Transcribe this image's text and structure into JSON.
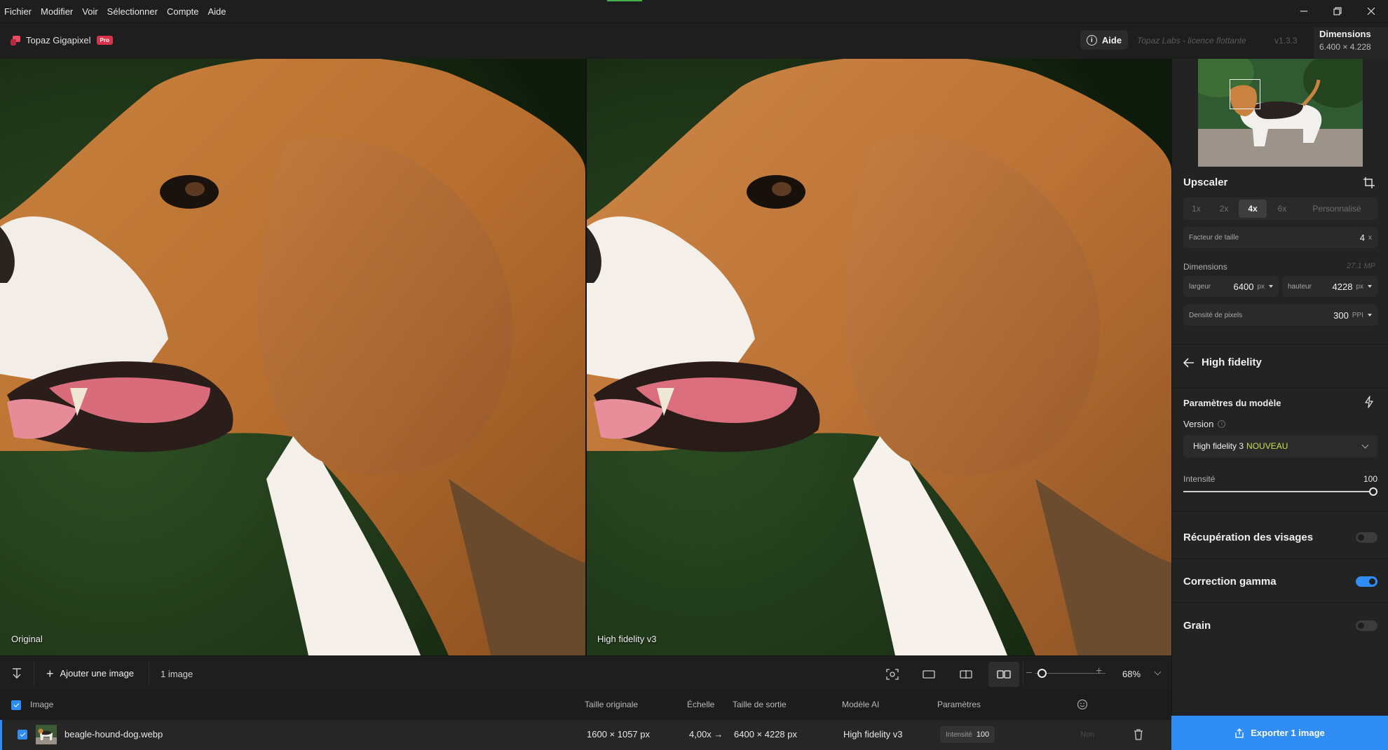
{
  "menu": {
    "items": [
      "Fichier",
      "Modifier",
      "Voir",
      "Sélectionner",
      "Compte",
      "Aide"
    ]
  },
  "window_controls": [
    "minimize-icon",
    "restore-icon",
    "close-icon"
  ],
  "app": {
    "name": "Topaz Gigapixel",
    "badge": "Pro",
    "help_label": "Aide",
    "license": "Topaz Labs - licence flottante",
    "version": "v1.3.3",
    "dimensions_title": "Dimensions",
    "dimensions_value": "6.400 × 4.228"
  },
  "preview": {
    "left_label": "Original",
    "right_label": "High fidelity v3"
  },
  "upscaler": {
    "title": "Upscaler",
    "scale_options": [
      "1x",
      "2x",
      "4x",
      "6x",
      "Personnalisé"
    ],
    "selected_scale": "4x",
    "size_factor_label": "Facteur de taille",
    "size_factor_value": "4",
    "size_factor_unit": "x",
    "dimensions_label": "Dimensions",
    "megapixels": "27.1 MP",
    "width_label": "largeur",
    "width_value": "6400",
    "width_unit": "px",
    "height_label": "hauteur",
    "height_value": "4228",
    "height_unit": "px",
    "density_label": "Densité de pixels",
    "density_value": "300",
    "density_unit": "PPI"
  },
  "model": {
    "name": "High fidelity",
    "params_title": "Paramètres du modèle",
    "version_label": "Version",
    "version_value": "High fidelity 3",
    "version_tag": "NOUVEAU",
    "intensity_label": "Intensité",
    "intensity_value": "100",
    "intensity_fraction": 1.0
  },
  "toggles": [
    {
      "label": "Récupération des visages",
      "on": false
    },
    {
      "label": "Correction gamma",
      "on": true
    },
    {
      "label": "Grain",
      "on": false
    }
  ],
  "toolbar": {
    "add_image": "Ajouter une image",
    "image_count": "1 image",
    "zoom": "68%"
  },
  "table": {
    "headers": {
      "image": "Image",
      "original_size": "Taille originale",
      "scale": "Échelle",
      "output_size": "Taille de sortie",
      "ai_model": "Modèle AI",
      "params": "Paramètres"
    },
    "row": {
      "filename": "beagle-hound-dog.webp",
      "original_size": "1600 × 1057 px",
      "scale": "4,00x →",
      "output_size": "6400 × 4228 px",
      "model": "High fidelity v3",
      "param_key": "Intensité",
      "param_value": "100",
      "face": "Non"
    }
  },
  "export_label": "Exporter 1 image",
  "colors": {
    "accent": "#2f8df3",
    "new_tag": "#c8e04a",
    "pro_badge": "#d9334b"
  }
}
